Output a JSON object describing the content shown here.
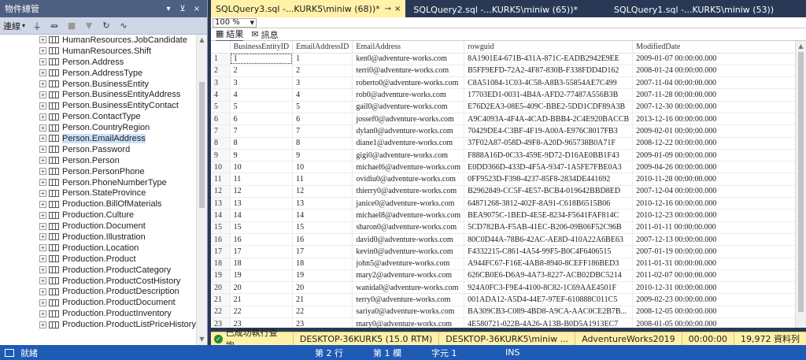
{
  "object_explorer": {
    "title": "物件總管",
    "pin": "⊻",
    "close": "×",
    "connect": "連線",
    "tree": [
      "HumanResources.JobCandidate",
      "HumanResources.Shift",
      "Person.Address",
      "Person.AddressType",
      "Person.BusinessEntity",
      "Person.BusinessEntityAddress",
      "Person.BusinessEntityContact",
      "Person.ContactType",
      "Person.CountryRegion",
      "Person.EmailAddress",
      "Person.Password",
      "Person.Person",
      "Person.PersonPhone",
      "Person.PhoneNumberType",
      "Person.StateProvince",
      "Production.BillOfMaterials",
      "Production.Culture",
      "Production.Document",
      "Production.Illustration",
      "Production.Location",
      "Production.Product",
      "Production.ProductCategory",
      "Production.ProductCostHistory",
      "Production.ProductDescription",
      "Production.ProductDocument",
      "Production.ProductInventory",
      "Production.ProductListPriceHistory"
    ],
    "selected_index": 9
  },
  "tabs": [
    {
      "label": "SQLQuery3.sql -...KURK5\\miniw (68))*",
      "active": true
    },
    {
      "label": "SQLQuery2.sql -...KURK5\\miniw (65))*",
      "active": false
    },
    {
      "label": "SQLQuery1.sql -...KURK5\\miniw (53))",
      "active": false
    }
  ],
  "zoom": "100 %",
  "result_tabs": {
    "results": "結果",
    "messages": "訊息"
  },
  "grid": {
    "columns": [
      "BusinessEntityID",
      "EmailAddressID",
      "EmailAddress",
      "rowguid",
      "ModifiedDate"
    ],
    "rows": [
      [
        "1",
        "1",
        "1",
        "ken0@adventure-works.com",
        "8A1901E4-671B-431A-871C-EADB2942E9EE",
        "2009-01-07 00:00:00.000"
      ],
      [
        "2",
        "2",
        "2",
        "terri0@adventure-works.com",
        "B5FF9EFD-72A2-4F87-830B-F338FDD4D162",
        "2008-01-24 00:00:00.000"
      ],
      [
        "3",
        "3",
        "3",
        "roberto0@adventure-works.com",
        "C8A51084-1C03-4C58-A8B3-55854AE7C499",
        "2007-11-04 00:00:00.000"
      ],
      [
        "4",
        "4",
        "4",
        "rob0@adventure-works.com",
        "17703ED1-0031-4B4A-AFD2-77487A556B3B",
        "2007-11-28 00:00:00.000"
      ],
      [
        "5",
        "5",
        "5",
        "gail0@adventure-works.com",
        "E76D2EA3-08E5-409C-BBE2-5DD1CDF89A3B",
        "2007-12-30 00:00:00.000"
      ],
      [
        "6",
        "6",
        "6",
        "jossef0@adventure-works.com",
        "A9C4093A-4F4A-4CAD-BBB4-2C4E920BACCB",
        "2013-12-16 00:00:00.000"
      ],
      [
        "7",
        "7",
        "7",
        "dylan0@adventure-works.com",
        "70429DE4-C3BF-4F19-A00A-E976C8017FB3",
        "2009-02-01 00:00:00.000"
      ],
      [
        "8",
        "8",
        "8",
        "diane1@adventure-works.com",
        "37F02A87-058D-49F8-A20D-965738B0A71F",
        "2008-12-22 00:00:00.000"
      ],
      [
        "9",
        "9",
        "9",
        "gigi0@adventure-works.com",
        "F888A16D-0C33-459E-9D72-D16AE0BB1F43",
        "2009-01-09 00:00:00.000"
      ],
      [
        "10",
        "10",
        "10",
        "michael6@adventure-works.com",
        "E0DD366D-433D-4F5A-9347-1A5FE7FBE0A3",
        "2009-04-26 00:00:00.000"
      ],
      [
        "11",
        "11",
        "11",
        "ovidiu0@adventure-works.com",
        "0FF9523D-F398-4237-85F8-2834DE441692",
        "2010-11-28 00:00:00.000"
      ],
      [
        "12",
        "12",
        "12",
        "thierry0@adventure-works.com",
        "B2962849-CC5F-4E57-BCB4-019642BBD8ED",
        "2007-12-04 00:00:00.000"
      ],
      [
        "13",
        "13",
        "13",
        "janice0@adventure-works.com",
        "64871268-3812-402F-8A91-C618B6515B06",
        "2010-12-16 00:00:00.000"
      ],
      [
        "14",
        "14",
        "14",
        "michael8@adventure-works.com",
        "BEA9075C-1BED-4E5E-8234-F5641FAF814C",
        "2010-12-23 00:00:00.000"
      ],
      [
        "15",
        "15",
        "15",
        "sharon0@adventure-works.com",
        "5CD782BA-F5AB-41EC-B206-09B06F52C96B",
        "2011-01-11 00:00:00.000"
      ],
      [
        "16",
        "16",
        "16",
        "david0@adventure-works.com",
        "80C0D44A-78B6-42AC-AE8D-410A22A6BE63",
        "2007-12-13 00:00:00.000"
      ],
      [
        "17",
        "17",
        "17",
        "kevin0@adventure-works.com",
        "F4332215-C861-4A54-99F5-B0C4F6406515",
        "2007-01-19 00:00:00.000"
      ],
      [
        "18",
        "18",
        "18",
        "john5@adventure-works.com",
        "A944FC67-F16E-4AB8-8940-8CEFF186BED3",
        "2011-01-31 00:00:00.000"
      ],
      [
        "19",
        "19",
        "19",
        "mary2@adventure-works.com",
        "626CB0E6-D6A9-4A73-8227-ACB02DBC5214",
        "2011-02-07 00:00:00.000"
      ],
      [
        "20",
        "20",
        "20",
        "wanida0@adventure-works.com",
        "924A0FC3-F9E4-4100-8C82-1C69AAE4501F",
        "2010-12-31 00:00:00.000"
      ],
      [
        "21",
        "21",
        "21",
        "terry0@adventure-works.com",
        "001ADA12-A5D4-44E7-97EF-610888C011C5",
        "2009-02-23 00:00:00.000"
      ],
      [
        "22",
        "22",
        "22",
        "sariya0@adventure-works.com",
        "BA309CB3-C089-4BD8-A9CA-AAC0CE2B7B...",
        "2008-12-05 00:00:00.000"
      ],
      [
        "23",
        "23",
        "23",
        "mary0@adventure-works.com",
        "4E580721-022B-4A26-A13B-B0D5A1913EC7",
        "2008-01-05 00:00:00.000"
      ]
    ]
  },
  "query_status": {
    "message": "已成功執行查詢。",
    "server": "DESKTOP-36KURK5 (15.0 RTM)",
    "user": "DESKTOP-36KURK5\\miniw ...",
    "database": "AdventureWorks2019",
    "elapsed": "00:00:00",
    "rows": "19,972 資料列"
  },
  "app_status": {
    "ready": "就緒",
    "line": "第 2 行",
    "col": "第 1 欄",
    "ch": "字元 1",
    "ins": "INS"
  }
}
